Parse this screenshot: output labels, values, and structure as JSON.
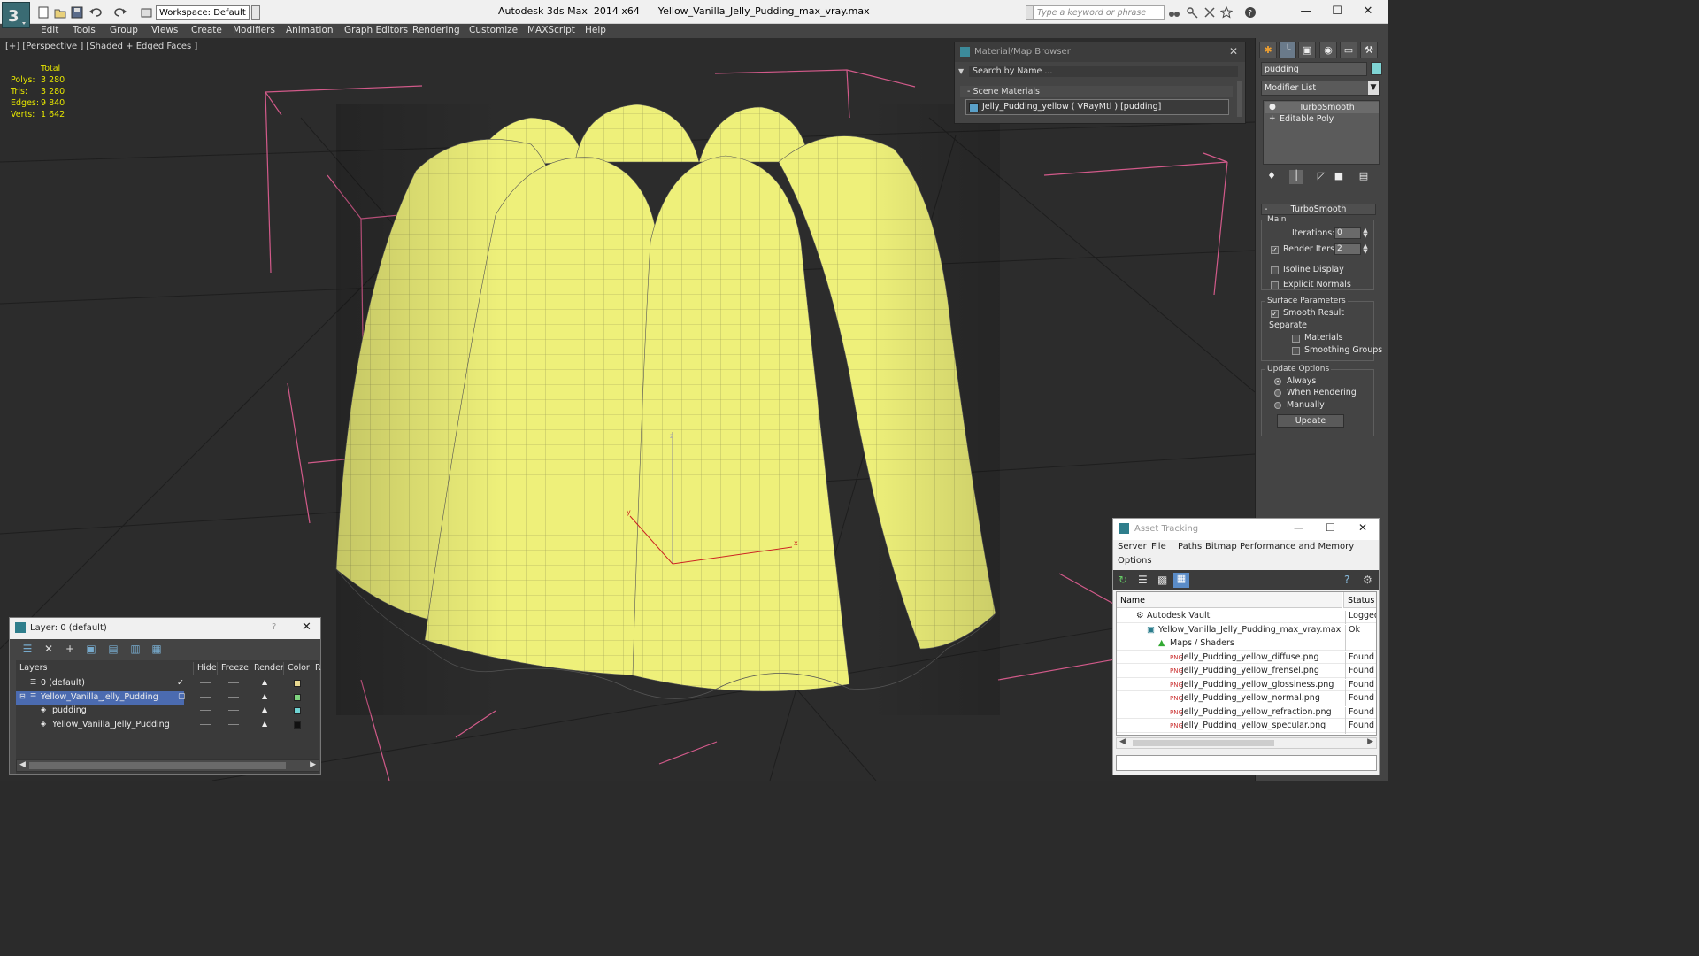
{
  "titlebar": {
    "workspace": "Workspace: Default",
    "title": "Autodesk 3ds Max  2014 x64      Yellow_Vanilla_Jelly_Pudding_max_vray.max",
    "search_placeholder": "Type a keyword or phrase"
  },
  "menu": [
    "Edit",
    "Tools",
    "Group",
    "Views",
    "Create",
    "Modifiers",
    "Animation",
    "Graph Editors",
    "Rendering",
    "Customize",
    "MAXScript",
    "Help"
  ],
  "viewport": {
    "label": "[+] [Perspective ] [Shaded + Edged Faces ]",
    "stats": {
      "header": "Total",
      "polys_label": "Polys:",
      "polys": "3 280",
      "tris_label": "Tris:",
      "tris": "3 280",
      "edges_label": "Edges:",
      "edges": "9 840",
      "verts_label": "Verts:",
      "verts": "1 642"
    },
    "gizmo": {
      "x": "x",
      "y": "y",
      "z": "z"
    },
    "mesh_color": "#eef07a"
  },
  "material_browser": {
    "title": "Material/Map Browser",
    "search": "Search by Name ...",
    "section": "Scene Materials",
    "material": "Jelly_Pudding_yellow ( VRayMtl ) [pudding]"
  },
  "command_panel": {
    "object_name": "pudding",
    "modifier_list": "Modifier List",
    "stack": [
      "TurboSmooth",
      "Editable Poly"
    ],
    "rollout_title": "TurboSmooth",
    "main_label": "Main",
    "iterations_label": "Iterations:",
    "iterations": "0",
    "render_iters_label": "Render Iters:",
    "render_iters": "2",
    "isoline": "Isoline Display",
    "explicit_normals": "Explicit Normals",
    "surface_params": "Surface Parameters",
    "smooth_result": "Smooth Result",
    "separate": "Separate",
    "materials": "Materials",
    "smoothing_groups": "Smoothing Groups",
    "update_options": "Update Options",
    "always": "Always",
    "when_rendering": "When Rendering",
    "manually": "Manually",
    "update_button": "Update"
  },
  "asset_tracking": {
    "title": "Asset Tracking",
    "menus": [
      "Server",
      "File",
      "Paths",
      "Bitmap Performance and Memory",
      "Options"
    ],
    "col_name": "Name",
    "col_status": "Status",
    "rows": [
      {
        "name": "Autodesk Vault",
        "status": "Logged"
      },
      {
        "name": "Yellow_Vanilla_Jelly_Pudding_max_vray.max",
        "status": "Ok"
      },
      {
        "name": "Maps / Shaders",
        "status": ""
      },
      {
        "name": "Jelly_Pudding_yellow_diffuse.png",
        "status": "Found"
      },
      {
        "name": "Jelly_Pudding_yellow_frensel.png",
        "status": "Found"
      },
      {
        "name": "Jelly_Pudding_yellow_glossiness.png",
        "status": "Found"
      },
      {
        "name": "Jelly_Pudding_yellow_normal.png",
        "status": "Found"
      },
      {
        "name": "Jelly_Pudding_yellow_refraction.png",
        "status": "Found"
      },
      {
        "name": "Jelly_Pudding_yellow_specular.png",
        "status": "Found"
      }
    ]
  },
  "layers": {
    "title": "Layer: 0 (default)",
    "help": "?",
    "cols": [
      "Layers",
      "Hide",
      "Freeze",
      "Render",
      "Color",
      "R"
    ],
    "rows": [
      {
        "name": "0 (default)",
        "color": "#e8d890"
      },
      {
        "name": "Yellow_Vanilla_Jelly_Pudding",
        "color": "#7fd47f"
      },
      {
        "name": "pudding",
        "color": "#6fd4d4"
      },
      {
        "name": "Yellow_Vanilla_Jelly_Pudding",
        "color": "#111111"
      }
    ]
  }
}
